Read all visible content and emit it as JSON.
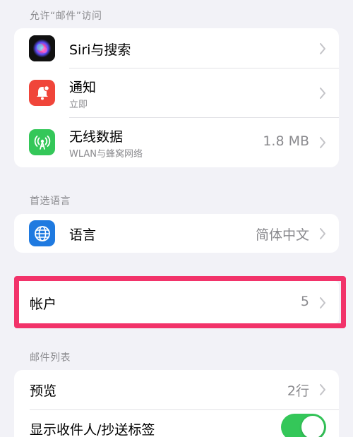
{
  "sections": {
    "access_header": "允许“邮件”访问",
    "language_header": "首选语言",
    "mail_list_header": "邮件列表"
  },
  "access": {
    "siri": {
      "title": "Siri与搜索",
      "icon": "siri-icon"
    },
    "notifications": {
      "title": "通知",
      "subtitle": "立即",
      "icon": "bell-icon",
      "color": "#f0453a"
    },
    "cellular": {
      "title": "无线数据",
      "subtitle": "WLAN与蜂窝网络",
      "value": "1.8 MB",
      "icon": "antenna-icon",
      "color": "#34c759"
    }
  },
  "language": {
    "title": "语言",
    "value": "简体中文",
    "icon": "globe-icon",
    "color": "#1f7ae0"
  },
  "accounts": {
    "title": "帐户",
    "value": "5"
  },
  "mail_list": {
    "preview": {
      "title": "预览",
      "value": "2行"
    },
    "show_to_cc": {
      "title": "显示收件人/抄送标签",
      "enabled": true
    }
  },
  "colors": {
    "highlight": "#f2336a",
    "toggle_on": "#34c759",
    "background": "#f2f2f7"
  }
}
